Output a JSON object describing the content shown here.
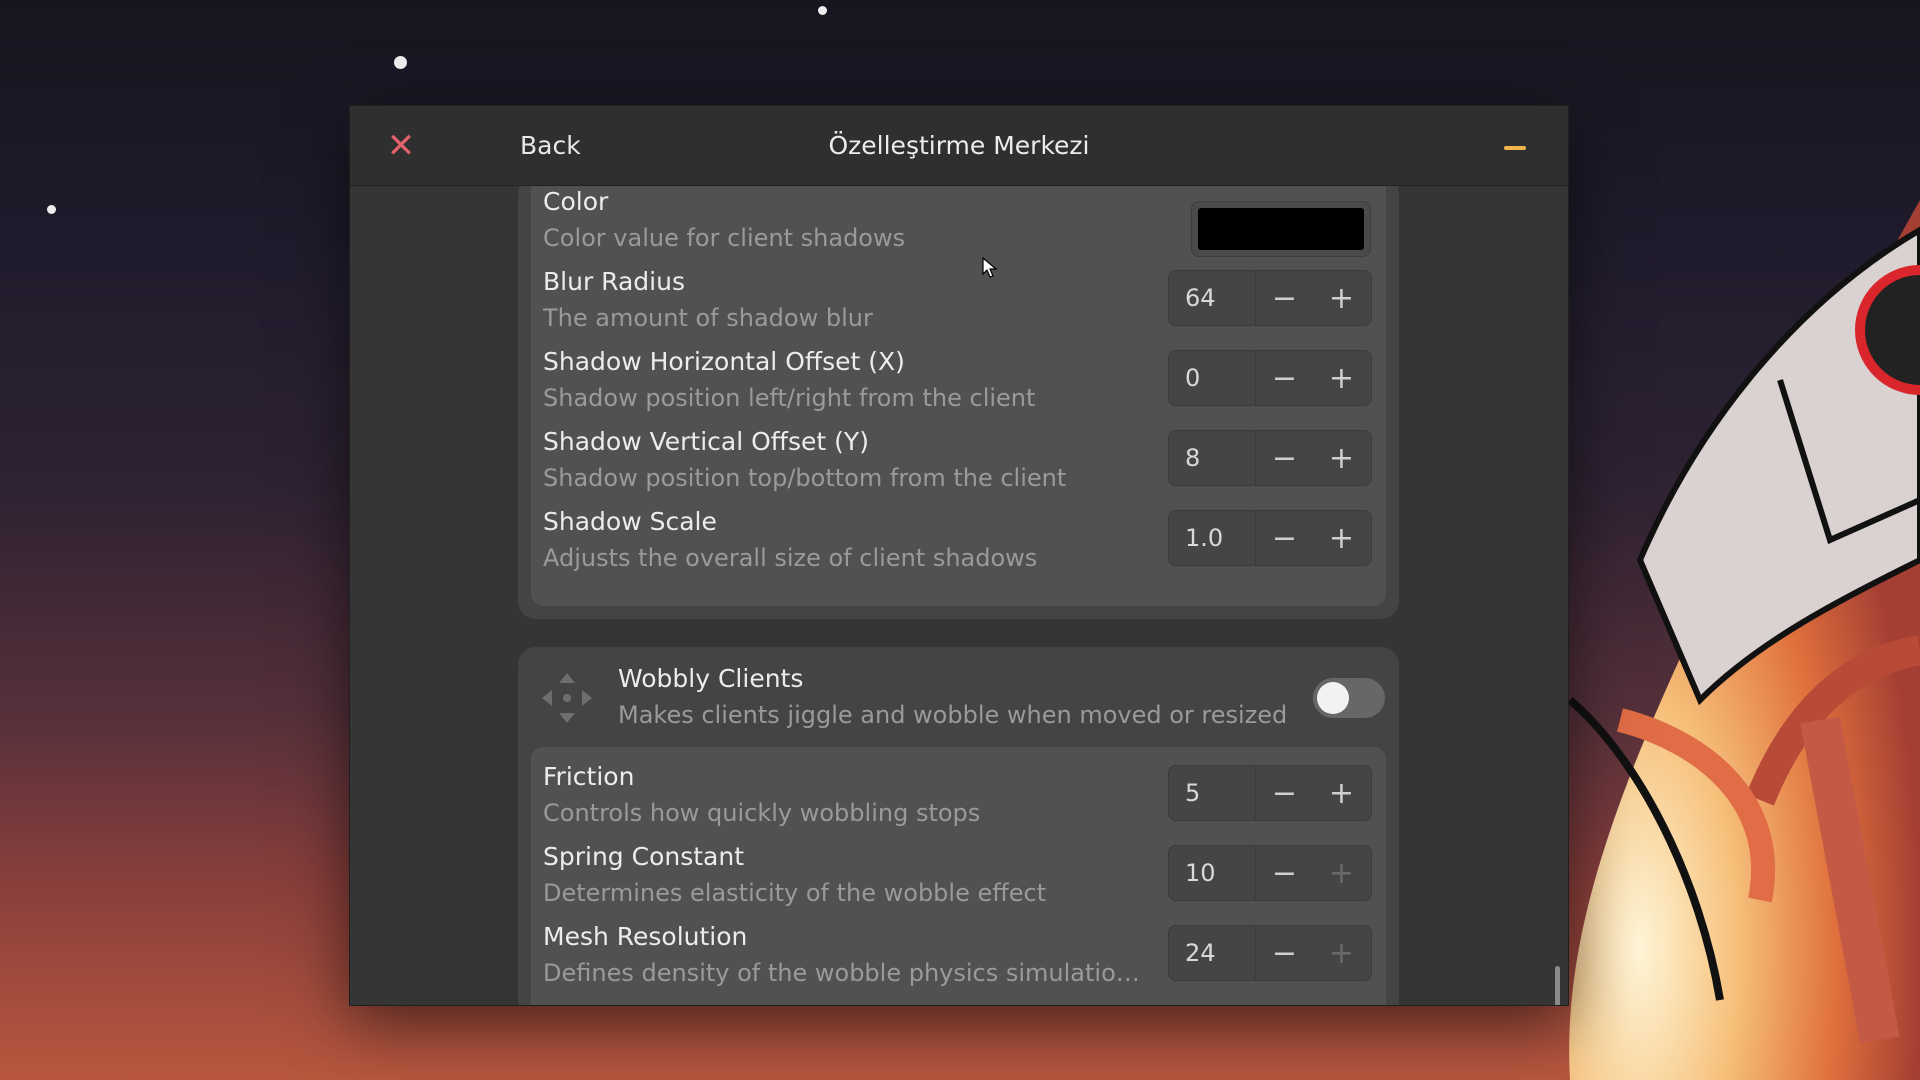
{
  "window": {
    "title": "Özelleştirme Merkezi",
    "back_label": "Back",
    "close_glyph": "✕",
    "close_icon": "close-icon",
    "minimize_icon": "minimize-icon"
  },
  "shadow_settings": {
    "color": {
      "title": "Color",
      "description": "Color value for client shadows",
      "value": "#000000"
    },
    "rows": [
      {
        "title": "Blur Radius",
        "description": "The amount of shadow blur",
        "value": "64",
        "plus_enabled": true
      },
      {
        "title": "Shadow Horizontal Offset (X)",
        "description": "Shadow position left/right from the client",
        "value": "0",
        "plus_enabled": true
      },
      {
        "title": "Shadow Vertical Offset (Y)",
        "description": "Shadow position top/bottom from the client",
        "value": "8",
        "plus_enabled": true
      },
      {
        "title": "Shadow Scale",
        "description": "Adjusts the overall size of client shadows",
        "value": "1.0",
        "plus_enabled": true
      }
    ]
  },
  "wobbly": {
    "title": "Wobbly Clients",
    "description": "Makes clients jiggle and wobble when moved or resized",
    "enabled": false,
    "icon": "move-arrows-icon",
    "rows": [
      {
        "title": "Friction",
        "description": "Controls how quickly wobbling stops",
        "value": "5",
        "plus_enabled": true
      },
      {
        "title": "Spring Constant",
        "description": "Determines elasticity of the wobble effect",
        "value": "10",
        "plus_enabled": false
      },
      {
        "title": "Mesh Resolution",
        "description": "Defines density of the wobble physics simulation g…",
        "value": "24",
        "plus_enabled": false
      }
    ]
  },
  "spin_glyphs": {
    "minus": "−",
    "plus": "+"
  },
  "colors": {
    "close": "#e0616a",
    "minimize": "#f0b54a",
    "window_bg": "#353535",
    "card_bg": "#444444",
    "row_group_bg": "#515151"
  }
}
